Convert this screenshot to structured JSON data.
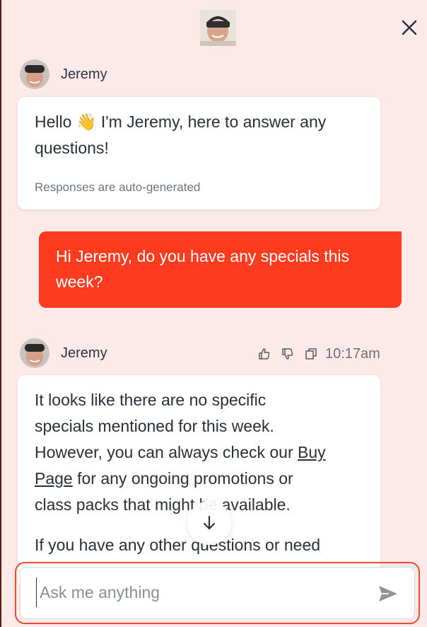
{
  "header": {
    "close_icon": "close-icon"
  },
  "messages": [
    {
      "sender": "Jeremy",
      "text_line1": "Hello 👋 I'm Jeremy, here to answer any",
      "text_line2": "questions!",
      "disclaimer": "Responses are auto-generated"
    },
    {
      "sender": "user",
      "text": "Hi Jeremy, do you have any specials this week?"
    },
    {
      "sender": "Jeremy",
      "time": "10:17am",
      "actions": [
        "thumbs-up-icon",
        "thumbs-down-icon",
        "copy-icon"
      ],
      "line1": "It looks like there are no specific",
      "line2": "specials mentioned for this week.",
      "line3_pre": "However, you can always check our ",
      "link_part1": "Buy",
      "link_part2": "Page",
      "line4_post": " for any ongoing promotions or",
      "line5": "class packs that might be available.",
      "line6": "If you have any other questions or need"
    }
  ],
  "input": {
    "placeholder": "Ask me anything",
    "value": "",
    "send_icon": "send-icon"
  },
  "colors": {
    "accent": "#ff3b1f",
    "background": "#fdeae8",
    "input_border": "#f04a32"
  }
}
